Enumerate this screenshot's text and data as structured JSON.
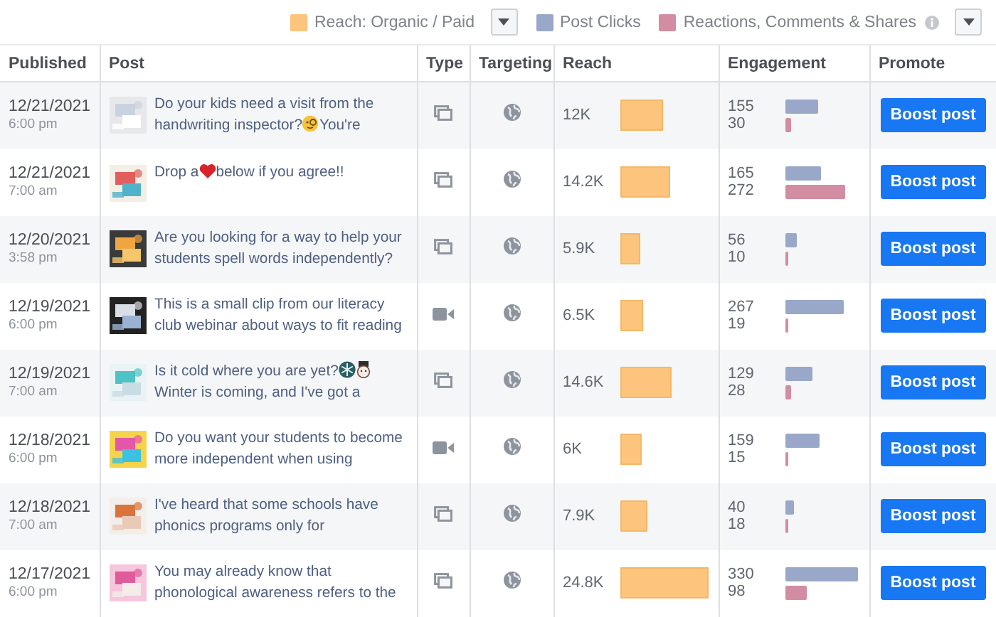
{
  "legend": [
    {
      "kind": "swatch",
      "label": "Reach: Organic / Paid",
      "color": "#fdc47d"
    },
    {
      "kind": "dropdown"
    },
    {
      "kind": "swatch",
      "label": "Post Clicks",
      "color": "#99a7c9"
    },
    {
      "kind": "swatch",
      "label": "Reactions, Comments & Shares",
      "color": "#d28da2"
    },
    {
      "kind": "info"
    },
    {
      "kind": "dropdown"
    }
  ],
  "columns": [
    "Published",
    "Post",
    "Type",
    "Targeting",
    "Reach",
    "Engagement",
    "Promote"
  ],
  "rows": [
    {
      "date": "12/21/2021",
      "time": "6:00 pm",
      "post": [
        [
          {
            "kind": "text",
            "text": "Do your kids need a visit from the"
          }
        ],
        [
          {
            "kind": "text",
            "text": "handwriting inspector?"
          },
          {
            "kind": "face"
          },
          {
            "kind": "text",
            "text": "You're"
          }
        ]
      ],
      "kind": "album",
      "reach": {
        "value": "12K"
      },
      "clicks": {
        "value": "155"
      },
      "reactions": {
        "value": "30"
      },
      "button": "Boost post"
    },
    {
      "date": "12/21/2021",
      "time": "7:00 am",
      "post": [
        [
          {
            "kind": "text",
            "text": "Drop a"
          },
          {
            "kind": "heart"
          },
          {
            "kind": "text",
            "text": "below if you agree!!"
          }
        ]
      ],
      "kind": "album",
      "reach": {
        "value": "14.2K"
      },
      "clicks": {
        "value": "165"
      },
      "reactions": {
        "value": "272"
      },
      "button": "Boost post"
    },
    {
      "date": "12/20/2021",
      "time": "3:58 pm",
      "post": [
        [
          {
            "kind": "text",
            "text": "Are you looking for a way to help your"
          }
        ],
        [
          {
            "kind": "text",
            "text": "students spell words independently?"
          }
        ]
      ],
      "kind": "album",
      "reach": {
        "value": "5.9K"
      },
      "clicks": {
        "value": "56"
      },
      "reactions": {
        "value": "10"
      },
      "button": "Boost post"
    },
    {
      "date": "12/19/2021",
      "time": "6:00 pm",
      "post": [
        [
          {
            "kind": "text",
            "text": "This is a small clip from our literacy"
          }
        ],
        [
          {
            "kind": "text",
            "text": "club webinar about ways to fit reading"
          }
        ]
      ],
      "kind": "video",
      "reach": {
        "value": "6.5K"
      },
      "clicks": {
        "value": "267"
      },
      "reactions": {
        "value": "19"
      },
      "button": "Boost post"
    },
    {
      "date": "12/19/2021",
      "time": "7:00 am",
      "post": [
        [
          {
            "kind": "text",
            "text": "Is it cold where you are yet?"
          },
          {
            "kind": "snowflake"
          },
          {
            "kind": "snowman"
          }
        ],
        [
          {
            "kind": "text",
            "text": "Winter is coming, and I've got a"
          }
        ]
      ],
      "kind": "album",
      "reach": {
        "value": "14.6K"
      },
      "clicks": {
        "value": "129"
      },
      "reactions": {
        "value": "28"
      },
      "button": "Boost post"
    },
    {
      "date": "12/18/2021",
      "time": "6:00 pm",
      "post": [
        [
          {
            "kind": "text",
            "text": "Do you want your students to become"
          }
        ],
        [
          {
            "kind": "text",
            "text": "more independent when using"
          }
        ]
      ],
      "kind": "video",
      "reach": {
        "value": "6K"
      },
      "clicks": {
        "value": "159"
      },
      "reactions": {
        "value": "15"
      },
      "button": "Boost post"
    },
    {
      "date": "12/18/2021",
      "time": "7:00 am",
      "post": [
        [
          {
            "kind": "text",
            "text": "I've heard that some schools have"
          }
        ],
        [
          {
            "kind": "text",
            "text": "phonics programs only for"
          }
        ]
      ],
      "kind": "album",
      "reach": {
        "value": "7.9K"
      },
      "clicks": {
        "value": "40"
      },
      "reactions": {
        "value": "18"
      },
      "button": "Boost post"
    },
    {
      "date": "12/17/2021",
      "time": "6:00 pm",
      "post": [
        [
          {
            "kind": "text",
            "text": "You may already know that"
          }
        ],
        [
          {
            "kind": "text",
            "text": "phonological awareness refers to the"
          }
        ]
      ],
      "kind": "album",
      "reach": {
        "value": "24.8K"
      },
      "clicks": {
        "value": "330"
      },
      "reactions": {
        "value": "98"
      },
      "button": "Boost post"
    }
  ]
}
